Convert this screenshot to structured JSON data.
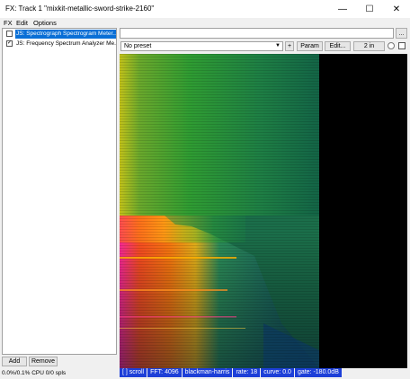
{
  "window": {
    "title": "FX: Track 1 \"mixkit-metallic-sword-strike-2160\"",
    "minimize": "—",
    "maximize": "☐",
    "close": "✕"
  },
  "menu": [
    "FX",
    "Edit",
    "Options"
  ],
  "fx_list": [
    {
      "label": "JS: Spectrograph Spectrogram Meter...",
      "checked": false,
      "check_glyph": "",
      "selected": true
    },
    {
      "label": "JS: Frequency Spectrum Analyzer Me...",
      "checked": true,
      "check_glyph": "✓",
      "selected": false
    }
  ],
  "buttons": {
    "add": "Add",
    "remove": "Remove",
    "browse": "...",
    "plus": "+",
    "param": "Param",
    "edit": "Edit...",
    "io": "2 in"
  },
  "preset": {
    "value": "No preset"
  },
  "cpu_status": "0.0%/0.1% CPU 0/0 spls",
  "spectrogram": {
    "status": [
      "[ ] scroll",
      "FFT: 4096",
      "blackman-harris",
      "rate: 18",
      "curve: 0.0",
      "gate: -180.0dB"
    ]
  },
  "colors": {
    "selection": "#0a6fd6",
    "status_bg": "#1d3fd8"
  }
}
